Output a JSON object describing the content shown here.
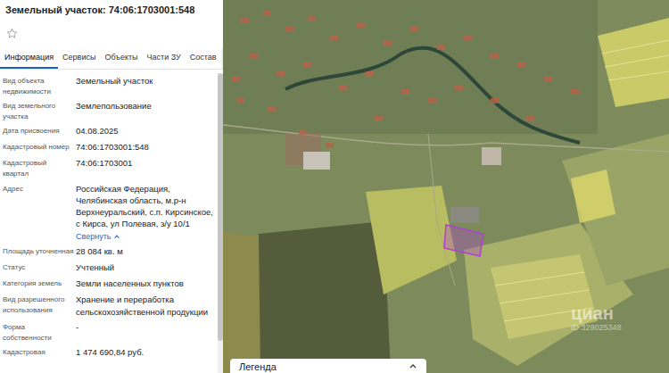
{
  "panel": {
    "title": "Земельный участок: 74:06:1703001:548",
    "starred": false
  },
  "tabs": [
    {
      "label": "Информация",
      "selected": true
    },
    {
      "label": "Сервисы",
      "selected": false
    },
    {
      "label": "Объекты",
      "selected": false
    },
    {
      "label": "Части ЗУ",
      "selected": false
    },
    {
      "label": "Состав",
      "selected": false
    }
  ],
  "fields": [
    {
      "kind": "text",
      "label": "Вид объекта недвижимости",
      "value": "Земельный участок"
    },
    {
      "kind": "text",
      "label": "Вид земельного участка",
      "value": "Землепользование"
    },
    {
      "kind": "text",
      "label": "Дата присвоения",
      "value": "04.08.2025"
    },
    {
      "kind": "text",
      "label": "Кадастровый номер",
      "value": "74:06:1703001:548"
    },
    {
      "kind": "text",
      "label": "Кадастровый квартал",
      "value": "74:06:1703001"
    },
    {
      "kind": "address",
      "label": "Адрес",
      "value": "Российская Федерация, Челябинская область, м.р-н Верхнеуральский, с.п. Кирсинское, с Кирса, ул Полевая, з/у 10/1",
      "link": "Свернуть"
    },
    {
      "kind": "text",
      "label": "Площадь уточненная",
      "value": "28 084 кв. м"
    },
    {
      "kind": "text",
      "label": "Статус",
      "value": "Учтенный"
    },
    {
      "kind": "text",
      "label": "Категория земель",
      "value": "Земли населенных пунктов"
    },
    {
      "kind": "text",
      "label": "Вид разрешенного использования",
      "value": "Хранение и переработка сельскохозяйственной продукции"
    },
    {
      "kind": "text",
      "label": "Форма собственности",
      "value": "-"
    },
    {
      "kind": "text",
      "label": "Кадастровая",
      "value": "1 474 690,84 руб."
    }
  ],
  "map": {
    "legend": {
      "title": "Легенда"
    },
    "watermark": {
      "logo": "циан",
      "id": "ID 329025348"
    }
  }
}
